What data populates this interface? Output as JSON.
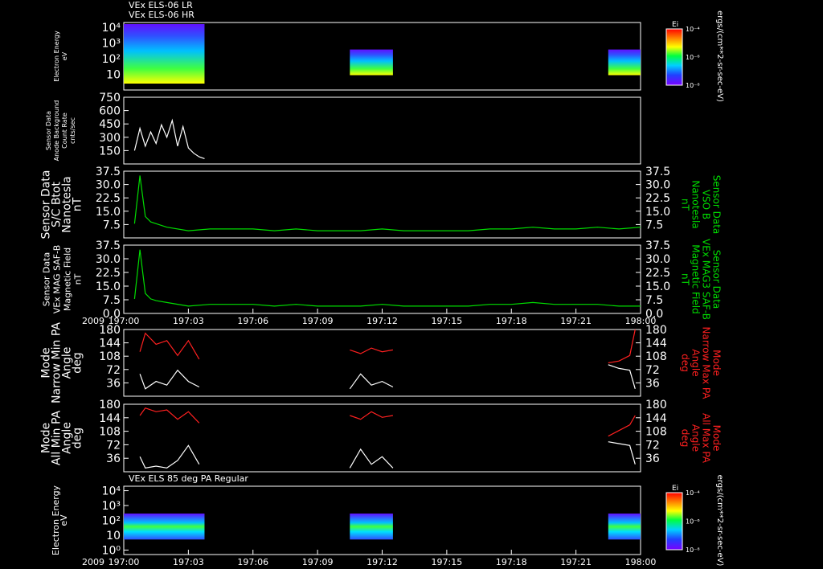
{
  "chart_data": [
    {
      "type": "heatmap",
      "titles": [
        "VEx ELS-06 LR",
        "VEx ELS-06 HR"
      ],
      "ylabel": [
        "Electron Energy",
        "eV"
      ],
      "yscale": "log",
      "ylim": [
        1,
        20000
      ],
      "yticks": [
        "10",
        "10²",
        "10³",
        "10⁴"
      ],
      "segments": [
        {
          "from": "197:00",
          "to": "197:03:45"
        },
        {
          "from": "197:10:30",
          "to": "197:12:30"
        },
        {
          "from": "197:22:30",
          "to": "198:00"
        }
      ],
      "colorbar": {
        "title": "Ei",
        "ticks": [
          "10⁻⁴",
          "10⁻⁶",
          "10⁻⁸"
        ]
      },
      "zlabel": "ergs/(cm**2-sr-sec-eV)"
    },
    {
      "type": "line",
      "ylabel": [
        "Sensor Data",
        "Anode Background",
        "Count Rate",
        "cnts/sec"
      ],
      "ylim": [
        0,
        750
      ],
      "yticks": [
        "150",
        "300",
        "450",
        "600",
        "750"
      ],
      "series": [
        {
          "color": "#ffffff",
          "x": [
            "197:00:30",
            "197:00:45",
            "197:01:00",
            "197:01:15",
            "197:01:30",
            "197:01:45",
            "197:02:00",
            "197:02:15",
            "197:02:30",
            "197:02:45",
            "197:03:00",
            "197:03:15",
            "197:03:30",
            "197:03:45"
          ],
          "y": [
            150,
            400,
            200,
            360,
            230,
            440,
            300,
            490,
            200,
            420,
            180,
            120,
            80,
            60
          ]
        }
      ]
    },
    {
      "type": "line",
      "ylabel": [
        "Sensor Data",
        "S/C Btot",
        "Nanotesla",
        "nT"
      ],
      "rlabel": [
        "Sensor Data",
        "VSO B",
        "Nanotesla",
        "nT"
      ],
      "ylim": [
        0,
        37.5
      ],
      "yticks": [
        "7.5",
        "15.0",
        "22.5",
        "30.0",
        "37.5"
      ],
      "series": [
        {
          "color": "#00dd00",
          "x": [
            "197:00:30",
            "197:00:45",
            "197:01:00",
            "197:01:15",
            "197:01:30",
            "197:02:00",
            "197:03:00",
            "197:04:00",
            "197:05:00",
            "197:06:00",
            "197:07:00",
            "197:08:00",
            "197:09:00",
            "197:10:00",
            "197:11:00",
            "197:12:00",
            "197:13:00",
            "197:14:00",
            "197:15:00",
            "197:16:00",
            "197:17:00",
            "197:18:00",
            "197:19:00",
            "197:20:00",
            "197:21:00",
            "197:22:00",
            "197:23:00",
            "198:00"
          ],
          "y": [
            8,
            35,
            12,
            9,
            8,
            6,
            4,
            5,
            5,
            5,
            4,
            5,
            4,
            4,
            4,
            5,
            4,
            4,
            4,
            4,
            5,
            5,
            6,
            5,
            5,
            6,
            5,
            6
          ]
        }
      ]
    },
    {
      "type": "line",
      "ylabel": [
        "Sensor Data",
        "VEx MAG SAF-B",
        "Magnetic Field",
        "nT"
      ],
      "rlabel": [
        "Sensor Data",
        "VEx MAG3 SAF-B",
        "Magnetic Field",
        "nT"
      ],
      "ylim": [
        0,
        37.5
      ],
      "yticks": [
        "0.0",
        "7.5",
        "15.0",
        "22.5",
        "30.0",
        "37.5"
      ],
      "series": [
        {
          "color": "#00dd00",
          "x": [
            "197:00:30",
            "197:00:45",
            "197:01:00",
            "197:01:15",
            "197:01:30",
            "197:02:00",
            "197:03:00",
            "197:04:00",
            "197:05:00",
            "197:06:00",
            "197:07:00",
            "197:08:00",
            "197:09:00",
            "197:10:00",
            "197:11:00",
            "197:12:00",
            "197:13:00",
            "197:14:00",
            "197:15:00",
            "197:16:00",
            "197:17:00",
            "197:18:00",
            "197:19:00",
            "197:20:00",
            "197:21:00",
            "197:22:00",
            "197:23:00",
            "198:00"
          ],
          "y": [
            8,
            35,
            11,
            8,
            7,
            6,
            4,
            5,
            5,
            5,
            4,
            5,
            4,
            4,
            4,
            5,
            4,
            4,
            4,
            4,
            5,
            5,
            6,
            5,
            5,
            5,
            4,
            4
          ]
        }
      ]
    },
    {
      "type": "line",
      "ylabel": [
        "Mode",
        "Narrow Min PA",
        "Angle",
        "deg"
      ],
      "rlabel": [
        "Mode",
        "Narrow Max PA",
        "Angle",
        "deg"
      ],
      "ylim": [
        0,
        180
      ],
      "yticks": [
        "36",
        "72",
        "108",
        "144",
        "180"
      ],
      "series": [
        {
          "color": "#ff2020",
          "x": [
            "197:00:45",
            "197:01:00",
            "197:01:30",
            "197:02:00",
            "197:02:30",
            "197:03:00",
            "197:03:30",
            "197:10:30",
            "197:11:00",
            "197:11:30",
            "197:12:00",
            "197:12:30",
            "197:22:30",
            "197:23:00",
            "197:23:30",
            "197:23:45"
          ],
          "y": [
            120,
            170,
            140,
            150,
            110,
            150,
            100,
            125,
            115,
            130,
            120,
            125,
            90,
            95,
            110,
            180
          ]
        },
        {
          "color": "#ffffff",
          "x": [
            "197:00:45",
            "197:01:00",
            "197:01:30",
            "197:02:00",
            "197:02:30",
            "197:03:00",
            "197:03:30",
            "197:10:30",
            "197:11:00",
            "197:11:30",
            "197:12:00",
            "197:12:30",
            "197:22:30",
            "197:23:00",
            "197:23:30",
            "197:23:45"
          ],
          "y": [
            60,
            20,
            40,
            30,
            70,
            40,
            25,
            20,
            60,
            30,
            40,
            25,
            85,
            75,
            70,
            20
          ]
        }
      ]
    },
    {
      "type": "line",
      "ylabel": [
        "Mode",
        "All Min PA",
        "Angle",
        "deg"
      ],
      "rlabel": [
        "Mode",
        "All Max PA",
        "Angle",
        "deg"
      ],
      "ylim": [
        0,
        180
      ],
      "yticks": [
        "36",
        "72",
        "108",
        "144",
        "180"
      ],
      "series": [
        {
          "color": "#ff2020",
          "x": [
            "197:00:45",
            "197:01:00",
            "197:01:30",
            "197:02:00",
            "197:02:30",
            "197:03:00",
            "197:03:30",
            "197:10:30",
            "197:11:00",
            "197:11:30",
            "197:12:00",
            "197:12:30",
            "197:22:30",
            "197:23:00",
            "197:23:30",
            "197:23:45"
          ],
          "y": [
            150,
            170,
            160,
            165,
            140,
            160,
            130,
            150,
            140,
            160,
            145,
            150,
            95,
            110,
            125,
            150
          ]
        },
        {
          "color": "#ffffff",
          "x": [
            "197:00:45",
            "197:01:00",
            "197:01:30",
            "197:02:00",
            "197:02:30",
            "197:03:00",
            "197:03:30",
            "197:10:30",
            "197:11:00",
            "197:11:30",
            "197:12:00",
            "197:12:30",
            "197:22:30",
            "197:23:00",
            "197:23:30",
            "197:23:45"
          ],
          "y": [
            40,
            10,
            15,
            10,
            30,
            70,
            20,
            10,
            60,
            20,
            40,
            10,
            80,
            75,
            70,
            20
          ]
        }
      ]
    },
    {
      "type": "heatmap",
      "titles": [
        "VEx ELS 85 deg PA Regular"
      ],
      "ylabel": [
        "Electron Energy",
        "eV"
      ],
      "yscale": "log",
      "ylim": [
        0.5,
        20000
      ],
      "yticks": [
        "10⁰",
        "10",
        "10²",
        "10³",
        "10⁴"
      ],
      "segments": [
        {
          "from": "197:00",
          "to": "197:03:45"
        },
        {
          "from": "197:10:30",
          "to": "197:12:30"
        },
        {
          "from": "197:22:30",
          "to": "198:00"
        }
      ],
      "colorbar": {
        "title": "Ei",
        "ticks": [
          "10⁻⁴",
          "10⁻⁶",
          "10⁻⁸"
        ]
      },
      "zlabel": "ergs/(cm**2-sr-sec-eV)"
    }
  ],
  "x_axis": {
    "year": "2009",
    "ticks": [
      "197:00",
      "197:03",
      "197:06",
      "197:09",
      "197:12",
      "197:15",
      "197:18",
      "197:21",
      "198:00"
    ]
  }
}
